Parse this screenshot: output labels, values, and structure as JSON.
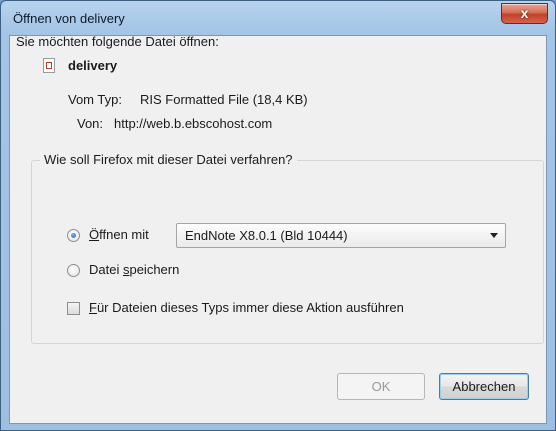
{
  "window": {
    "title": "Öffnen von delivery",
    "close_symbol": "x"
  },
  "dialog": {
    "prompt": "Sie möchten folgende Datei öffnen:",
    "file": {
      "icon": "ris-file-icon",
      "name": "delivery",
      "type_label": "Vom Typ:",
      "type_value": "RIS Formatted File (18,4 KB)",
      "from_label": "Von:",
      "from_value": "http://web.b.ebscohost.com"
    },
    "action_group": {
      "legend": "Wie soll Firefox mit dieser Datei verfahren?",
      "open_with": {
        "label_accel": "Ö",
        "label_rest": "ffnen mit",
        "selected": true
      },
      "application_select": {
        "value": "EndNote X8.0.1 (Bld 10444)"
      },
      "save_file": {
        "label_pre": "Datei ",
        "label_accel": "s",
        "label_rest": "peichern",
        "selected": false
      },
      "remember": {
        "label_accel": "F",
        "label_rest": "ür Dateien dieses Typs immer diese Aktion ausführen",
        "checked": false
      }
    },
    "buttons": {
      "ok": "OK",
      "cancel": "Abbrechen"
    }
  },
  "colors": {
    "frame": "#a4c5e6",
    "close": "#c2412a",
    "client": "#f0f0f0",
    "radio_dot": "#1f5fb8"
  }
}
